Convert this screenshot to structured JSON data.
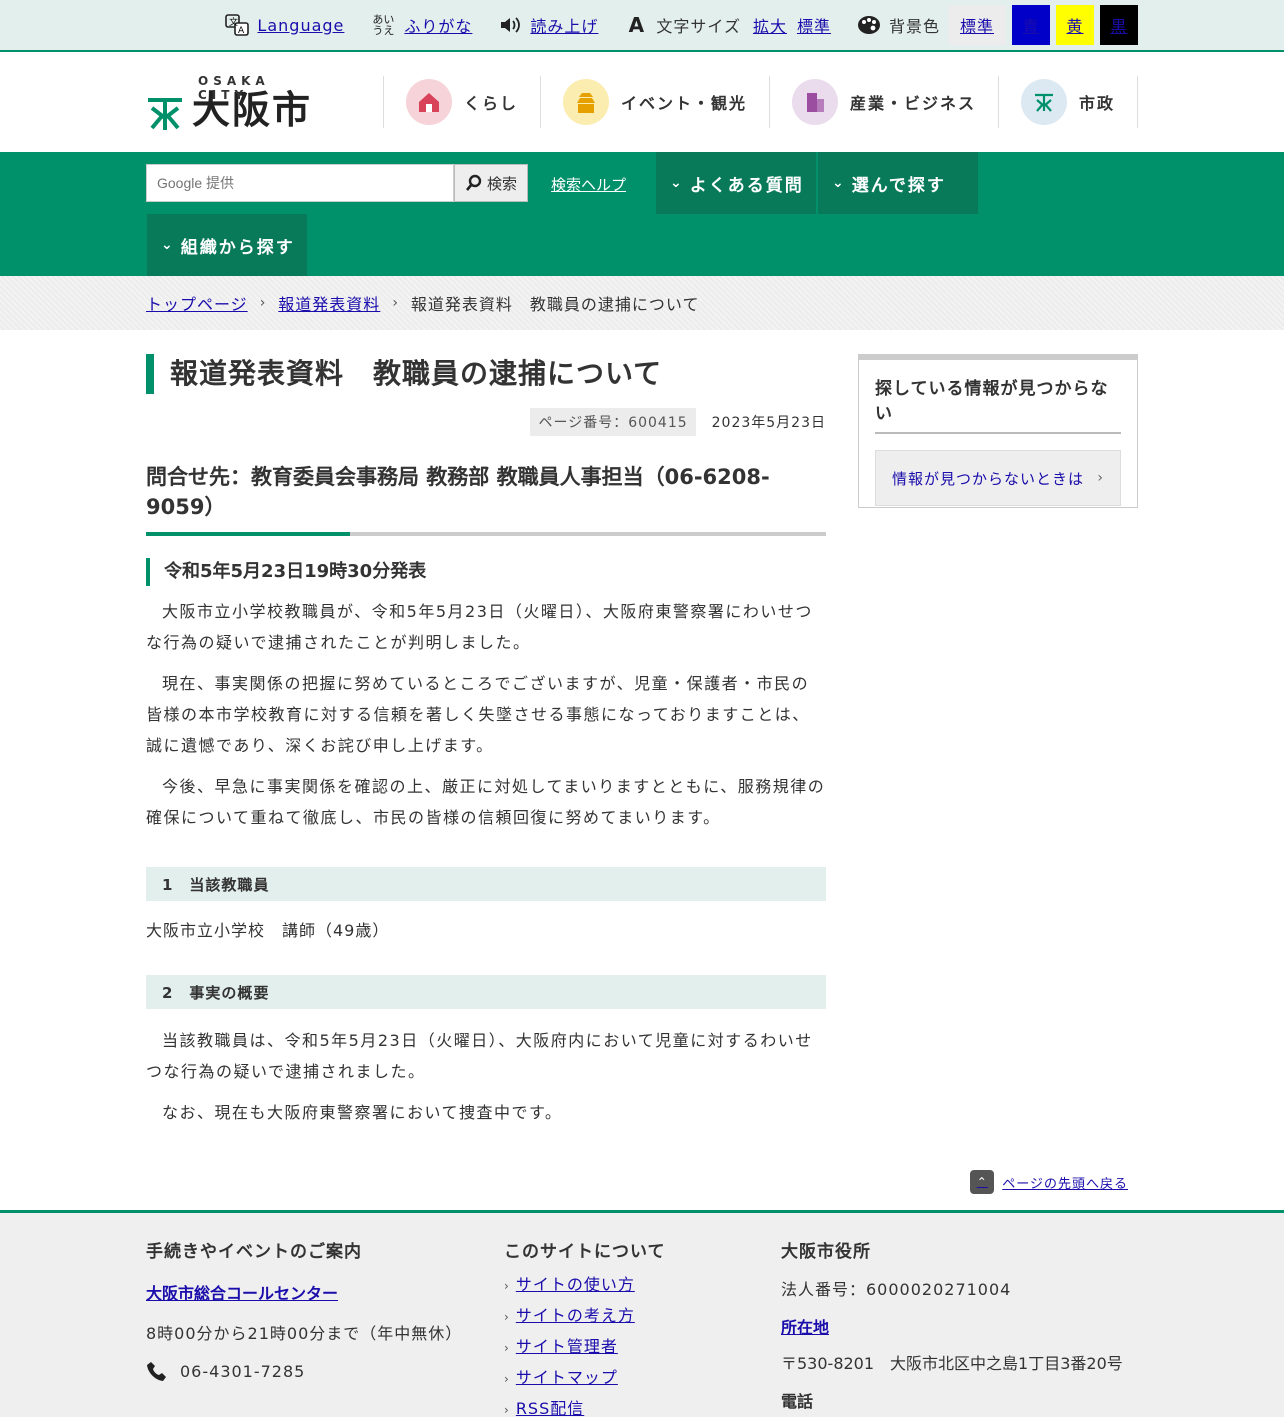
{
  "util": {
    "language": "Language",
    "furigana": "ふりがな",
    "read_aloud": "読み上げ",
    "font_size_label": "文字サイズ",
    "font_enlarge": "拡大",
    "font_standard": "標準",
    "bg_label": "背景色",
    "bg_standard": "標準",
    "bg_blue": "青",
    "bg_yellow": "黄",
    "bg_black": "黒"
  },
  "logo": {
    "sub": "OSAKA CITY",
    "name": "大阪市"
  },
  "gnav": [
    {
      "label": "くらし",
      "color": "#f6d3d8"
    },
    {
      "label": "イベント・観光",
      "color": "#fbecb0"
    },
    {
      "label": "産業・ビジネス",
      "color": "#eadcec"
    },
    {
      "label": "市政",
      "color": "#dce9f3"
    }
  ],
  "search": {
    "placeholder": "Google 提供",
    "button": "検索",
    "help_prefix": "検索",
    "help_link": "ヘルプ"
  },
  "dropdowns": {
    "faq": "よくある質問",
    "choose": "選んで探す",
    "org": "組織から探す"
  },
  "breadcrumb": {
    "top": "トップページ",
    "press": "報道発表資料",
    "current": "報道発表資料　教職員の逮捕について"
  },
  "article": {
    "title": "報道発表資料　教職員の逮捕について",
    "page_number": "ページ番号：600415",
    "date": "2023年5月23日",
    "contact": "問合せ先：教育委員会事務局 教務部 教職員人事担当（06-6208-9059）",
    "announce": "令和5年5月23日19時30分発表",
    "paragraphs": [
      "大阪市立小学校教職員が、令和5年5月23日（火曜日）、大阪府東警察署にわいせつな行為の疑いで逮捕されたことが判明しました。",
      "現在、事実関係の把握に努めているところでございますが、児童・保護者・市民の皆様の本市学校教育に対する信頼を著しく失墜させる事態になっておりますことは、誠に遺憾であり、深くお詫び申し上げます。",
      "今後、早急に事実関係を確認の上、厳正に対処してまいりますとともに、服務規律の確保について重ねて徹底し、市民の皆様の信頼回復に努めてまいります。"
    ],
    "section1_title": "1　当該教職員",
    "section1_text": "大阪市立小学校　講師（49歳）",
    "section2_title": "2　事実の概要",
    "section2_paragraphs": [
      "当該教職員は、令和5年5月23日（火曜日）、大阪府内において児童に対するわいせつな行為の疑いで逮捕されました。",
      "なお、現在も大阪府東警察署において捜査中です。"
    ]
  },
  "sidebar": {
    "title": "探している情報が見つからない",
    "button": "情報が見つからないときは"
  },
  "to_top": "ページの先頭へ戻る",
  "footer": {
    "col1": {
      "heading": "手続きやイベントのご案内",
      "link": "大阪市総合コールセンター",
      "hours": "8時00分から21時00分まで（年中無休）",
      "phone": "06-4301-7285"
    },
    "col2": {
      "heading": "このサイトについて",
      "links": [
        "サイトの使い方",
        "サイトの考え方",
        "サイト管理者",
        "サイトマップ",
        "RSS配信"
      ]
    },
    "col3": {
      "heading": "大阪市役所",
      "corp_no": "法人番号：6000020271004",
      "location_link": "所在地",
      "address": "〒530-8201　大阪市北区中之島1丁目3番20号",
      "phone_label": "電話"
    }
  }
}
